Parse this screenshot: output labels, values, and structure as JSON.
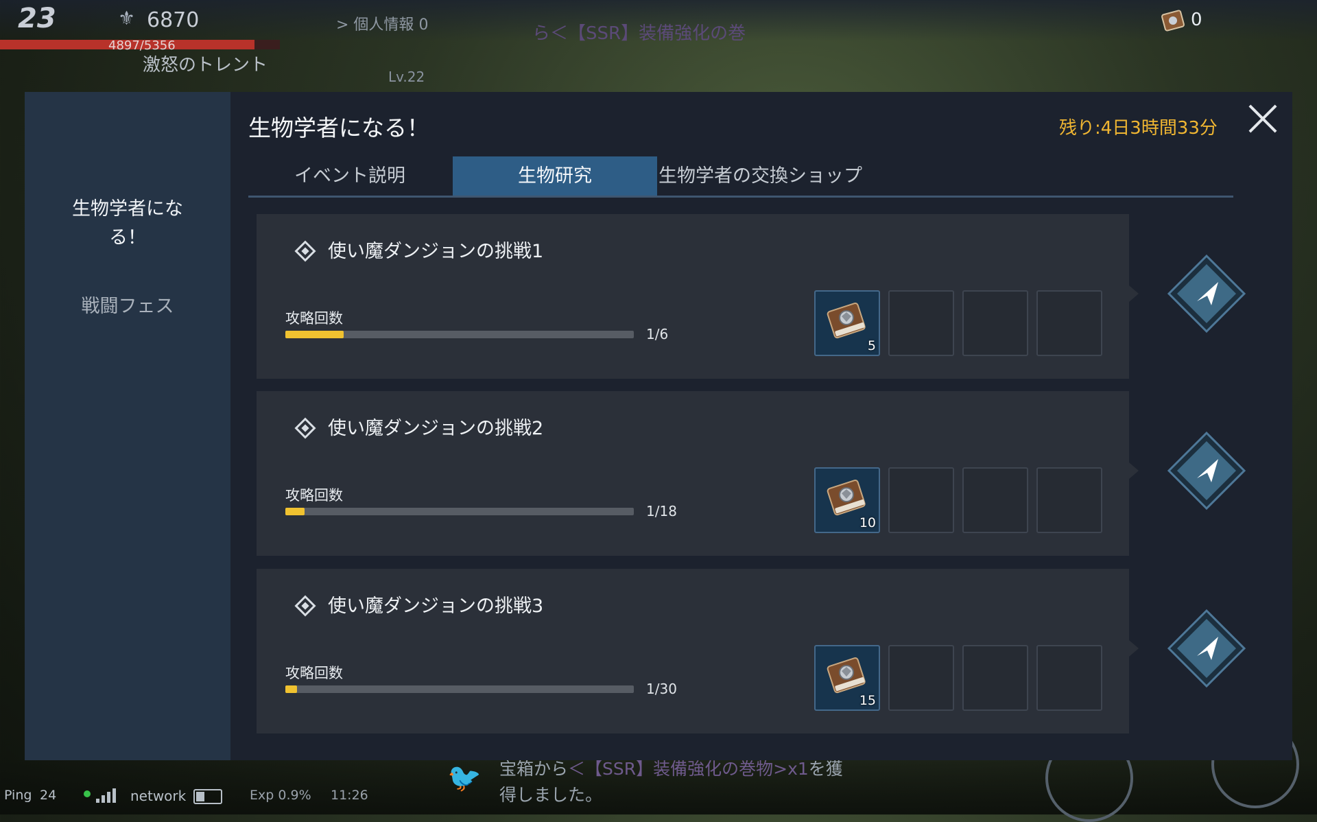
{
  "hud": {
    "level": "23",
    "power": "6870",
    "hp_text": "4897/5356",
    "target_name": "激怒のトレント",
    "profile_link": "> 個人情報",
    "profile_count": "0",
    "notice": "ら＜【SSR】装備強化の巻",
    "enemy_level": "Lv.22",
    "scroll_count": "0"
  },
  "status_bar": {
    "ping_label": "Ping",
    "ping_value": "24",
    "network_label": "network",
    "exp": "Exp 0.9%",
    "time": "11:26"
  },
  "chat": {
    "line1_prefix": "宝箱から",
    "line1_highlight": "＜【SSR】装備強化の巻物>x1",
    "line1_suffix": "を獲",
    "line2": "得しました。"
  },
  "sidebar": {
    "items": [
      {
        "label": "生物学者にな\nる！"
      },
      {
        "label": "戦闘フェス"
      }
    ]
  },
  "modal": {
    "title": "生物学者になる！",
    "remaining": "残り:4日3時間33分",
    "tabs": [
      {
        "label": "イベント説明"
      },
      {
        "label": "生物研究"
      },
      {
        "label": "生物学者の交換ショップ"
      }
    ],
    "quests": [
      {
        "title": "使い魔ダンジョンの挑戦1",
        "count_label": "攻略回数",
        "progress_text": "1/6",
        "progress": 0.1667,
        "reward_qty": "5"
      },
      {
        "title": "使い魔ダンジョンの挑戦2",
        "count_label": "攻略回数",
        "progress_text": "1/18",
        "progress": 0.0556,
        "reward_qty": "10"
      },
      {
        "title": "使い魔ダンジョンの挑戦3",
        "count_label": "攻略回数",
        "progress_text": "1/30",
        "progress": 0.0333,
        "reward_qty": "15"
      }
    ]
  },
  "colors": {
    "accent_tab": "#2e5d86",
    "timer": "#f0b632",
    "progress_fill": "#f0c230"
  }
}
